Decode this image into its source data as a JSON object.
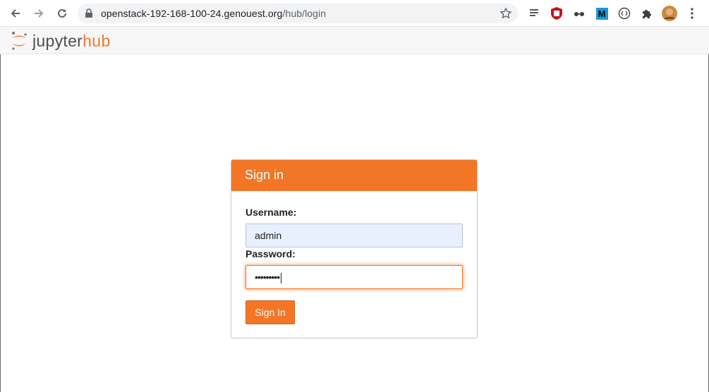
{
  "browser": {
    "url_host": "openstack-192-168-100-24.genouest.org",
    "url_path": "/hub/login",
    "back_icon": "arrow-left",
    "forward_icon": "arrow-right",
    "reload_icon": "reload",
    "lock_icon": "lock",
    "bookmark_icon": "star",
    "extensions": [
      "reading-list",
      "ublock",
      "glasses",
      "m-extension",
      "code-extension",
      "puzzle",
      "avatar",
      "menu-dots"
    ],
    "m_ext_label": "M"
  },
  "header": {
    "logo_prefix": "jupyter",
    "logo_suffix": "hub"
  },
  "login": {
    "title": "Sign in",
    "username_label": "Username:",
    "username_value": "admin",
    "password_label": "Password:",
    "password_mask": "•••••••••",
    "button_label": "Sign In"
  },
  "colors": {
    "accent": "#f37626",
    "autofill": "#e8f0fe"
  }
}
